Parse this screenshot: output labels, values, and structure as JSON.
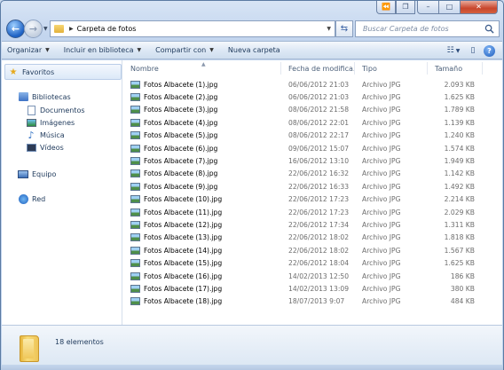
{
  "window": {
    "caption_buttons": {
      "minimize": "–",
      "maximize": "□",
      "close": "✕"
    }
  },
  "address_bar": {
    "breadcrumb": "Carpeta de fotos",
    "search_placeholder": "Buscar Carpeta de fotos"
  },
  "toolbar": {
    "items": [
      {
        "label": "Organizar",
        "has_dropdown": true
      },
      {
        "label": "Incluir en biblioteca",
        "has_dropdown": true
      },
      {
        "label": "Compartir con",
        "has_dropdown": true
      },
      {
        "label": "Nueva carpeta",
        "has_dropdown": false
      }
    ]
  },
  "navigation": {
    "favorites": "Favoritos",
    "libraries": "Bibliotecas",
    "library_items": [
      "Documentos",
      "Imágenes",
      "Música",
      "Vídeos"
    ],
    "computer": "Equipo",
    "network": "Red"
  },
  "columns": {
    "name": "Nombre",
    "date": "Fecha de modifica...",
    "type": "Tipo",
    "size": "Tamaño"
  },
  "files": [
    {
      "name": "Fotos Albacete (1).jpg",
      "date": "06/06/2012 21:03",
      "type": "Archivo JPG",
      "size": "2.093 KB"
    },
    {
      "name": "Fotos Albacete (2).jpg",
      "date": "06/06/2012 21:03",
      "type": "Archivo JPG",
      "size": "1.625 KB"
    },
    {
      "name": "Fotos Albacete (3).jpg",
      "date": "08/06/2012 21:58",
      "type": "Archivo JPG",
      "size": "1.789 KB"
    },
    {
      "name": "Fotos Albacete (4).jpg",
      "date": "08/06/2012 22:01",
      "type": "Archivo JPG",
      "size": "1.139 KB"
    },
    {
      "name": "Fotos Albacete (5).jpg",
      "date": "08/06/2012 22:17",
      "type": "Archivo JPG",
      "size": "1.240 KB"
    },
    {
      "name": "Fotos Albacete (6).jpg",
      "date": "09/06/2012 15:07",
      "type": "Archivo JPG",
      "size": "1.574 KB"
    },
    {
      "name": "Fotos Albacete (7).jpg",
      "date": "16/06/2012 13:10",
      "type": "Archivo JPG",
      "size": "1.949 KB"
    },
    {
      "name": "Fotos Albacete (8).jpg",
      "date": "22/06/2012 16:32",
      "type": "Archivo JPG",
      "size": "1.142 KB"
    },
    {
      "name": "Fotos Albacete (9).jpg",
      "date": "22/06/2012 16:33",
      "type": "Archivo JPG",
      "size": "1.492 KB"
    },
    {
      "name": "Fotos Albacete (10).jpg",
      "date": "22/06/2012 17:23",
      "type": "Archivo JPG",
      "size": "2.214 KB"
    },
    {
      "name": "Fotos Albacete (11).jpg",
      "date": "22/06/2012 17:23",
      "type": "Archivo JPG",
      "size": "2.029 KB"
    },
    {
      "name": "Fotos Albacete (12).jpg",
      "date": "22/06/2012 17:34",
      "type": "Archivo JPG",
      "size": "1.311 KB"
    },
    {
      "name": "Fotos Albacete (13).jpg",
      "date": "22/06/2012 18:02",
      "type": "Archivo JPG",
      "size": "1.818 KB"
    },
    {
      "name": "Fotos Albacete (14).jpg",
      "date": "22/06/2012 18:02",
      "type": "Archivo JPG",
      "size": "1.567 KB"
    },
    {
      "name": "Fotos Albacete (15).jpg",
      "date": "22/06/2012 18:04",
      "type": "Archivo JPG",
      "size": "1.625 KB"
    },
    {
      "name": "Fotos Albacete (16).jpg",
      "date": "14/02/2013 12:50",
      "type": "Archivo JPG",
      "size": "186 KB"
    },
    {
      "name": "Fotos Albacete (17).jpg",
      "date": "14/02/2013 13:09",
      "type": "Archivo JPG",
      "size": "380 KB"
    },
    {
      "name": "Fotos Albacete (18).jpg",
      "date": "18/07/2013 9:07",
      "type": "Archivo JPG",
      "size": "484 KB"
    }
  ],
  "status": {
    "item_count": "18 elementos"
  },
  "icons": [
    "back-arrow-icon",
    "forward-arrow-icon",
    "folder-icon",
    "refresh-icon",
    "search-icon",
    "views-icon",
    "preview-pane-icon",
    "help-icon",
    "star-icon",
    "library-icon",
    "documents-icon",
    "pictures-icon",
    "music-icon",
    "videos-icon",
    "computer-icon",
    "network-icon",
    "jpg-file-icon"
  ],
  "colors": {
    "chrome": "#c3d5ee",
    "text": "#1e395b",
    "close_button": "#c8462c"
  }
}
